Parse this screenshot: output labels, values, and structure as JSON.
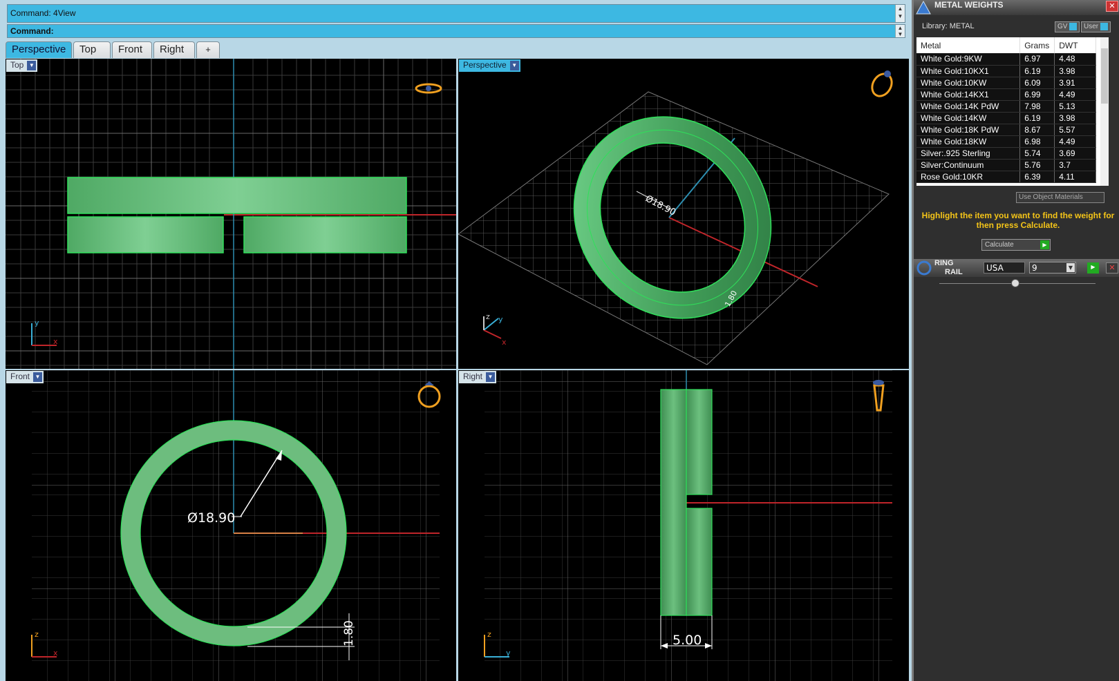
{
  "command": {
    "history": "Command: 4View",
    "prompt": "Command:"
  },
  "tabs": [
    "Perspective",
    "Top",
    "Front",
    "Right",
    "+"
  ],
  "viewports": {
    "top": {
      "label": "Top"
    },
    "perspective": {
      "label": "Perspective",
      "dimension": "Ø18.90",
      "dimension_small": "1.80"
    },
    "front": {
      "label": "Front",
      "diameter": "Ø18.90",
      "thickness": "1.80"
    },
    "right": {
      "label": "Right",
      "width": "5.00"
    }
  },
  "axes": {
    "x": "x",
    "y": "y",
    "z": "z"
  },
  "panel": {
    "title": "METAL WEIGHTS",
    "library": "Library: METAL",
    "toggle_gv": "GV",
    "toggle_user": "User",
    "columns": [
      "Metal",
      "Grams",
      "DWT"
    ],
    "rows": [
      [
        "White Gold:9KW",
        "6.97",
        "4.48"
      ],
      [
        "White Gold:10KX1",
        "6.19",
        "3.98"
      ],
      [
        "White Gold:10KW",
        "6.09",
        "3.91"
      ],
      [
        "White Gold:14KX1",
        "6.99",
        "4.49"
      ],
      [
        "White Gold:14K PdW",
        "7.98",
        "5.13"
      ],
      [
        "White Gold:14KW",
        "6.19",
        "3.98"
      ],
      [
        "White Gold:18K PdW",
        "8.67",
        "5.57"
      ],
      [
        "White Gold:18KW",
        "6.98",
        "4.49"
      ],
      [
        "Silver:.925 Sterling",
        "5.74",
        "3.69"
      ],
      [
        "Silver:Continuum",
        "5.76",
        "3.7"
      ],
      [
        "Rose Gold:10KR",
        "6.39",
        "4.11"
      ]
    ],
    "use_object_materials": "Use Object Materials",
    "hint": "Highlight the item you want to find the weight for then press Calculate.",
    "calculate": "Calculate"
  },
  "ring_rail": {
    "title_1": "RING",
    "title_2": "RAIL",
    "standard": "USA",
    "size": "9"
  },
  "colors": {
    "ring": "#5fbf75",
    "edge": "#2fe05a",
    "accent": "#3db8e2",
    "axis_x": "#c0252a",
    "axis_y": "#3ab0d8",
    "gizmo": "#f0a020",
    "hint": "#f5c518"
  }
}
